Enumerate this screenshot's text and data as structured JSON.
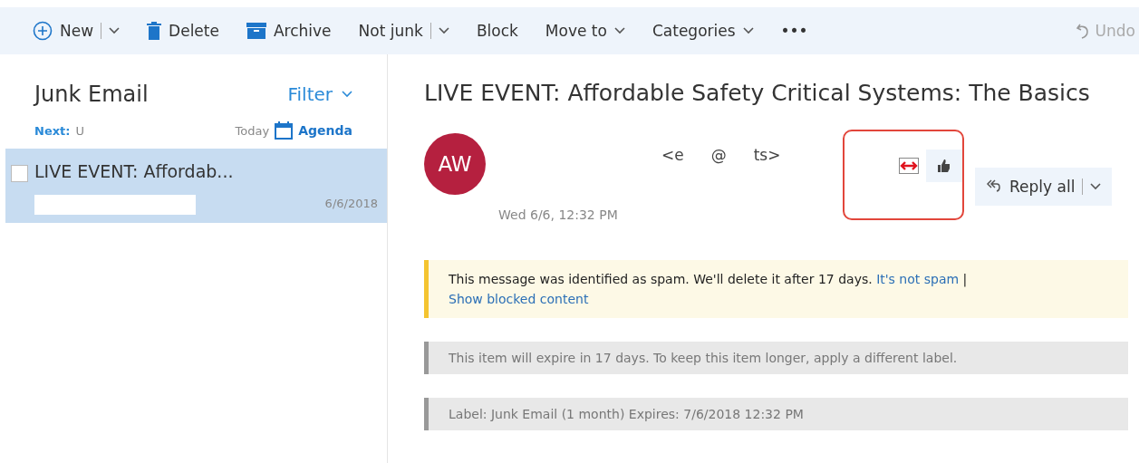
{
  "toolbar": {
    "items": [
      {
        "kind": "new",
        "label": "New",
        "split": true
      },
      {
        "kind": "delete",
        "label": "Delete",
        "split": false
      },
      {
        "kind": "archive",
        "label": "Archive",
        "split": false
      },
      {
        "kind": "plain",
        "label": "Not junk",
        "split": true
      },
      {
        "kind": "plain",
        "label": "Block",
        "split": false
      },
      {
        "kind": "menu",
        "label": "Move to",
        "split": false
      },
      {
        "kind": "menu",
        "label": "Categories",
        "split": false
      },
      {
        "kind": "plain",
        "label": "•••",
        "split": false
      }
    ],
    "undo": {
      "label": "Undo",
      "disabled": true
    }
  },
  "folder": {
    "title": "Junk Email",
    "filter": "Filter",
    "next_label": "Next:",
    "next_text": "U",
    "today": "Today",
    "agenda": "Agenda"
  },
  "messages": [
    {
      "subject": "LIVE EVENT: Affordab...",
      "date": "6/6/2018",
      "selected": true,
      "checked": false
    }
  ],
  "reading": {
    "subject": "LIVE EVENT: Affordable Safety Critical Systems: The Basics",
    "initials": "AW",
    "sender_parts": [
      "<e",
      "@",
      "ts>"
    ],
    "time": "Wed 6/6, 12:32 PM",
    "reply": "Reply all",
    "spam_notice": {
      "text": "This message was identified as spam. We'll delete it after 17 days.",
      "link": "It's not spam",
      "separator": "|",
      "link2": "Show blocked content"
    },
    "notes": [
      "This item will expire in 17 days. To keep this item longer, apply a different label.",
      "Label: Junk Email (1 month) Expires: 7/6/2018 12:32 PM"
    ]
  }
}
